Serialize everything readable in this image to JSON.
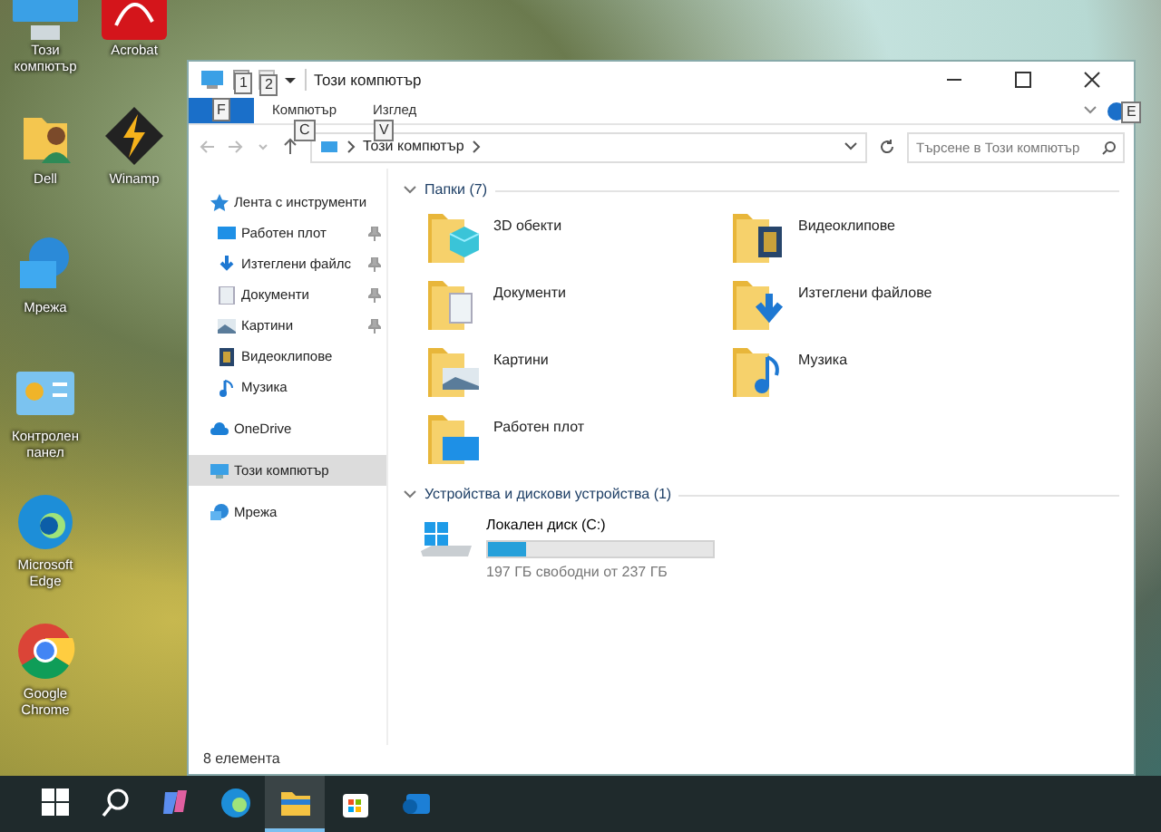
{
  "desktop_icons": {
    "column_1": [
      {
        "label": "Този компютър",
        "kind": "computer"
      },
      {
        "label": "Dell",
        "kind": "user-folder"
      },
      {
        "label": "Мрежа",
        "kind": "network"
      },
      {
        "label": "Контролен панел",
        "kind": "control-panel"
      },
      {
        "label": "Microsoft Edge",
        "kind": "edge"
      },
      {
        "label": "Google Chrome",
        "kind": "chrome"
      }
    ],
    "column_2": [
      {
        "label": "Acrobat",
        "kind": "acrobat"
      },
      {
        "label": "Winamp",
        "kind": "winamp"
      }
    ]
  },
  "window": {
    "title": "Този компютър",
    "ribbon_tabs": [
      {
        "label": "F",
        "kind": "file",
        "selected": false
      },
      {
        "label": "Компютър",
        "kind": "tab",
        "selected": false
      },
      {
        "label": "Изглед",
        "kind": "tab",
        "selected": false
      }
    ],
    "keytips": [
      {
        "label": "1",
        "kind": "qat-1"
      },
      {
        "label": "2",
        "kind": "qat-2"
      },
      {
        "label": "C",
        "kind": "tab-1"
      },
      {
        "label": "V",
        "kind": "tab-2"
      },
      {
        "label": "E",
        "kind": "help"
      }
    ],
    "address": {
      "path": "Този компютър"
    },
    "search": {
      "placeholder": "Търсене в Този компютър"
    },
    "nav_pane": [
      {
        "label": "Лента с инструменти",
        "kind": "star",
        "selected": false,
        "children": [
          {
            "label": "Работен плот",
            "kind": "desktop",
            "pinned": true,
            "selected": false
          },
          {
            "label": "Изтеглени файлс",
            "kind": "download",
            "pinned": true,
            "selected": false
          },
          {
            "label": "Документи",
            "kind": "document",
            "pinned": true,
            "selected": false
          },
          {
            "label": "Картини",
            "kind": "picture",
            "pinned": true,
            "selected": false
          },
          {
            "label": "Видеоклипове",
            "kind": "video",
            "pinned": false,
            "selected": false
          },
          {
            "label": "Музика",
            "kind": "music",
            "pinned": false,
            "selected": false
          }
        ]
      },
      {
        "label": "OneDrive",
        "kind": "cloud",
        "selected": false
      },
      {
        "label": "Този компютър",
        "kind": "computer",
        "selected": true
      },
      {
        "label": "Мрежа",
        "kind": "network",
        "selected": false
      }
    ],
    "groups": [
      {
        "title": "Папки (7)",
        "expanded": true,
        "kind": "folders",
        "items": [
          {
            "label": "3D обекти",
            "kind": "cube"
          },
          {
            "label": "Видеоклипове",
            "kind": "video"
          },
          {
            "label": "Документи",
            "kind": "document"
          },
          {
            "label": "Изтеглени файлове",
            "kind": "download"
          },
          {
            "label": "Картини",
            "kind": "picture"
          },
          {
            "label": "Музика",
            "kind": "music"
          },
          {
            "label": "Работен плот",
            "kind": "desktop"
          }
        ]
      },
      {
        "title": "Устройства и дискови устройства (1)",
        "expanded": true,
        "kind": "drives",
        "items": [
          {
            "label": "Локален диск (C:)",
            "level": 0.17,
            "reading": "197 ГБ свободни от 237 ГБ"
          }
        ]
      }
    ],
    "status_bar": "8 елемента"
  },
  "taskbar": [
    {
      "kind": "start",
      "selected": false
    },
    {
      "kind": "search",
      "selected": false
    },
    {
      "kind": "copilot",
      "selected": false
    },
    {
      "kind": "edge",
      "selected": false
    },
    {
      "kind": "explorer",
      "selected": true
    },
    {
      "kind": "store",
      "selected": false
    },
    {
      "kind": "mail",
      "selected": false
    }
  ]
}
